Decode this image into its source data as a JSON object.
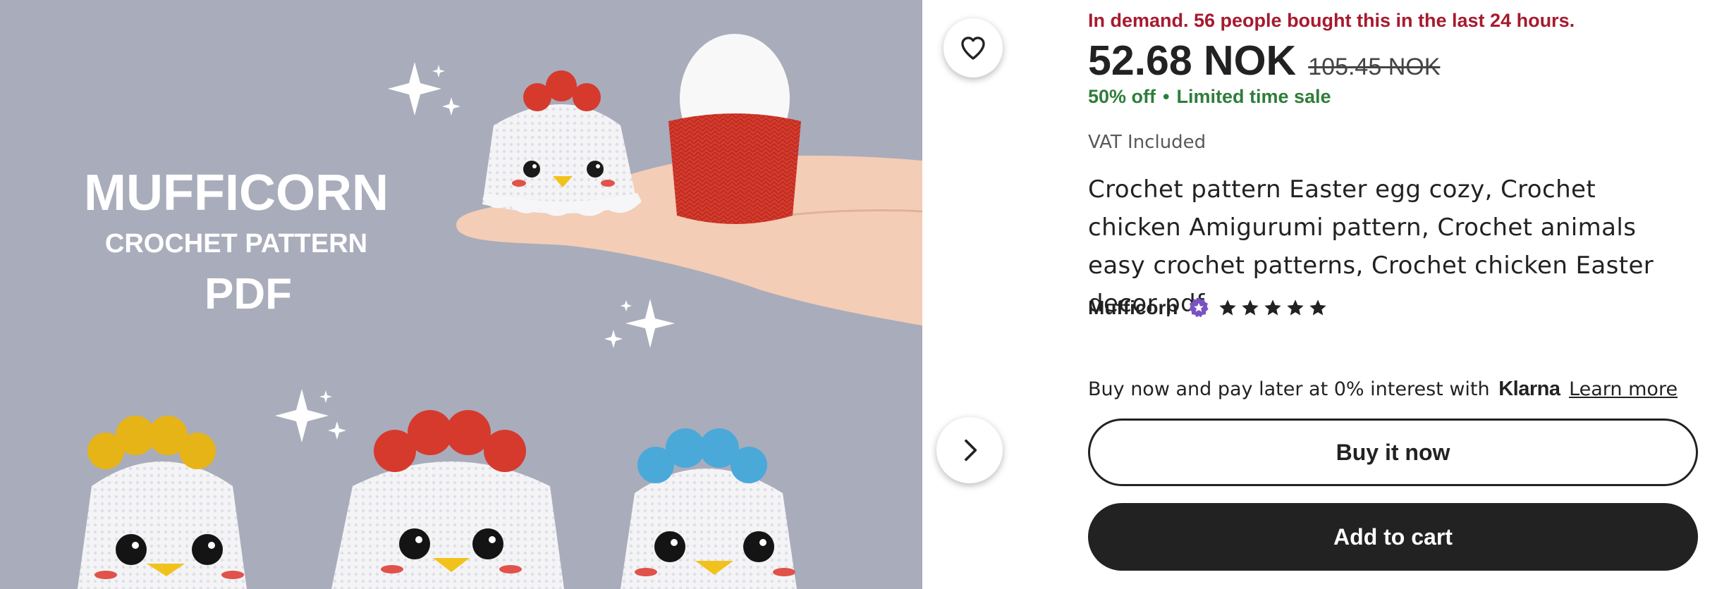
{
  "image": {
    "overlay_line1": "MUFFICORN",
    "overlay_line2": "CROCHET PATTERN",
    "overlay_line3": "PDF"
  },
  "demand_text": "In demand. 56 people bought this in the last 24 hours.",
  "price": {
    "current": "52.68 NOK",
    "original": "105.45 NOK"
  },
  "sale": {
    "discount": "50% off",
    "separator": "•",
    "label": "Limited time sale"
  },
  "vat_text": "VAT Included",
  "title": "Crochet pattern Easter egg cozy, Crochet chicken Amigurumi pattern, Crochet animals easy crochet patterns, Crochet chicken Easter decor pdf",
  "shop": {
    "name": "Mufficorn",
    "rating": 5,
    "max_rating": 5
  },
  "klarna": {
    "text": "Buy now and pay later at 0% interest with",
    "logo": "Klarna",
    "link": "Learn more"
  },
  "buttons": {
    "buy_now": "Buy it now",
    "add_to_cart": "Add to cart"
  },
  "colors": {
    "demand": "#a61a2e",
    "sale": "#2f7d3b",
    "star_seller_badge": "#7b52c1",
    "primary_button": "#222222"
  },
  "icons": {
    "favorite": "heart-outline-icon",
    "next": "chevron-right-icon",
    "star_seller": "star-seller-badge-icon",
    "rating": "star-icon"
  }
}
